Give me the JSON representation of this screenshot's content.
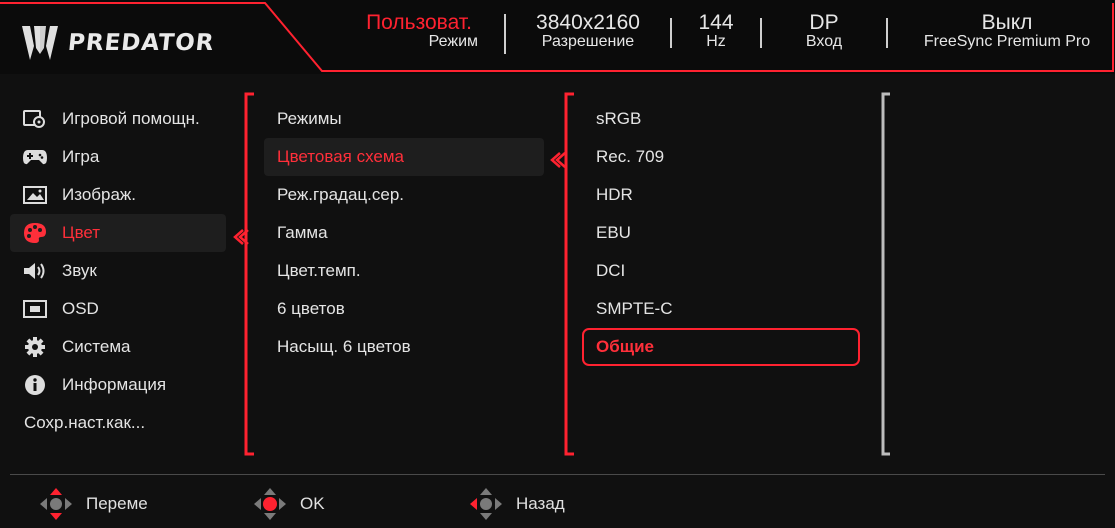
{
  "header": {
    "brand": "PREDATOR",
    "mode": {
      "value": "Пользоват.",
      "label": "Режим"
    },
    "resolution": {
      "value": "3840x2160",
      "label": "Разрешение"
    },
    "refresh": {
      "value": "144",
      "label": "Hz"
    },
    "input": {
      "value": "DP",
      "label": "Вход"
    },
    "freesync": {
      "value": "Выкл",
      "label": "FreeSync Premium Pro"
    }
  },
  "main_menu": {
    "items": [
      {
        "label": "Игровой помощн.",
        "icon": "gaming-assist-icon"
      },
      {
        "label": "Игра",
        "icon": "gamepad-icon"
      },
      {
        "label": "Изображ.",
        "icon": "image-icon"
      },
      {
        "label": "Цвет",
        "icon": "palette-icon",
        "selected": true
      },
      {
        "label": "Звук",
        "icon": "speaker-icon"
      },
      {
        "label": "OSD",
        "icon": "osd-icon"
      },
      {
        "label": "Система",
        "icon": "gear-icon"
      },
      {
        "label": "Информация",
        "icon": "info-icon"
      },
      {
        "label": "Сохр.наст.как...",
        "icon": ""
      }
    ]
  },
  "sub_menu": {
    "items": [
      {
        "label": "Режимы"
      },
      {
        "label": "Цветовая схема",
        "selected": true
      },
      {
        "label": "Реж.градац.сер."
      },
      {
        "label": "Гамма"
      },
      {
        "label": "Цвет.темп."
      },
      {
        "label": "6 цветов"
      },
      {
        "label": "Насыщ. 6 цветов"
      }
    ]
  },
  "options": {
    "items": [
      {
        "label": "sRGB"
      },
      {
        "label": "Rec. 709"
      },
      {
        "label": "HDR"
      },
      {
        "label": "EBU"
      },
      {
        "label": "DCI"
      },
      {
        "label": "SMPTE-C"
      },
      {
        "label": "Общие",
        "selected": true
      }
    ]
  },
  "footer": {
    "move": "Переме",
    "ok": "OK",
    "back": "Назад"
  },
  "colors": {
    "accent": "#ff2230",
    "background": "#101010",
    "text": "#e6e6e6"
  }
}
